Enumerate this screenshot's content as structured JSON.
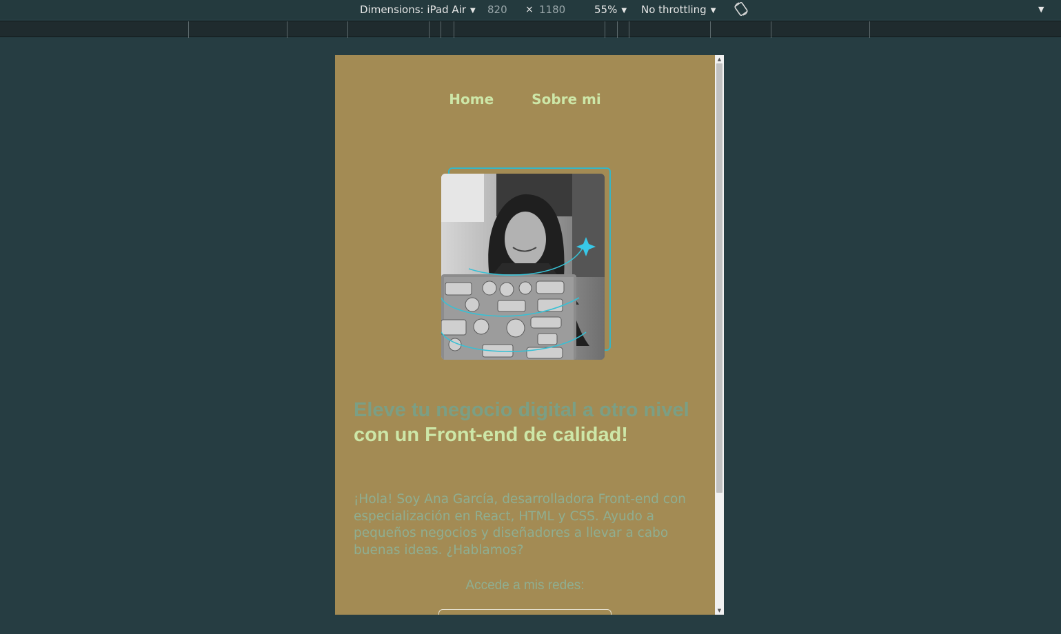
{
  "devtools": {
    "dimensions_label": "Dimensions: iPad Air",
    "width": "820",
    "times": "×",
    "height": "1180",
    "zoom": "55%",
    "throttling": "No throttling",
    "icons": [
      "caret-down-icon",
      "rotate-icon",
      "more-options-icon"
    ]
  },
  "page": {
    "nav": {
      "home": "Home",
      "about": "Sobre mi"
    },
    "hero": {
      "headline_accent": "Eleve tu negocio digital a otro nivel",
      "headline_main": "con un Front-end de calidad!",
      "intro": "¡Hola! Soy Ana García, desarrolladora Front-end con especialización en React, HTML y CSS. Ayudo a pequeños negocios y diseñadores a llevar a cabo buenas ideas. ¿Hablamos?",
      "social_label": "Accede a mis redes:"
    },
    "colors": {
      "background": "#a38b54",
      "nav_text": "#cde7a8",
      "headline_accent": "#7b9f85",
      "headline_main": "#cde7a8",
      "body_text": "#8fae91",
      "frame_accent": "#35b6c6"
    }
  }
}
